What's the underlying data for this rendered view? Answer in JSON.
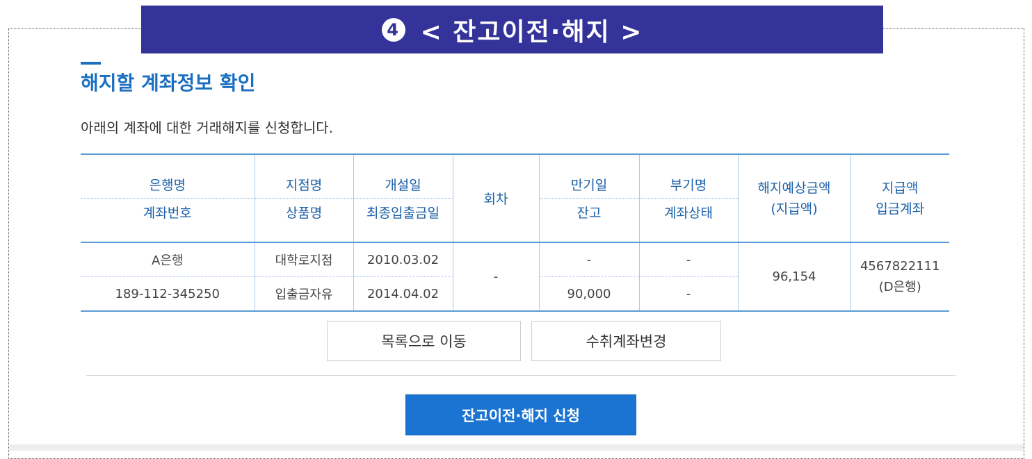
{
  "banner": {
    "number": "4",
    "title": "< 잔고이전·해지 >"
  },
  "page_title": "해지할 계좌정보 확인",
  "description": "아래의 계좌에 대한 거래해지를 신청합니다.",
  "table": {
    "headers": {
      "bank_name": "은행명",
      "account_number": "계좌번호",
      "branch_name": "지점명",
      "product_name": "상품명",
      "open_date": "개설일",
      "last_transaction_date": "최종입출금일",
      "installment": "회차",
      "maturity_date": "만기일",
      "balance": "잔고",
      "sub_name": "부기명",
      "account_status": "계좌상태",
      "expected_amount": "해지예상금액\n(지급액)",
      "payout": "지급액\n입금계좌"
    },
    "row": {
      "bank_name": "A은행",
      "account_number": "189-112-345250",
      "branch_name": "대학로지점",
      "product_name": "입출금자유",
      "open_date": "2010.03.02",
      "last_transaction_date": "2014.04.02",
      "installment": "-",
      "maturity_date": "-",
      "balance": "90,000",
      "sub_name": "-",
      "account_status": "-",
      "expected_amount": "96,154",
      "payout_account": "4567822111\n(D은행)"
    }
  },
  "buttons": {
    "list": "목록으로 이동",
    "change_account": "수취계좌변경",
    "submit": "잔고이전·해지 신청"
  },
  "colors": {
    "banner_bg": "#333399",
    "accent": "#1a6fc0",
    "amount": "#d9302c",
    "submit_bg": "#1b74d1"
  }
}
